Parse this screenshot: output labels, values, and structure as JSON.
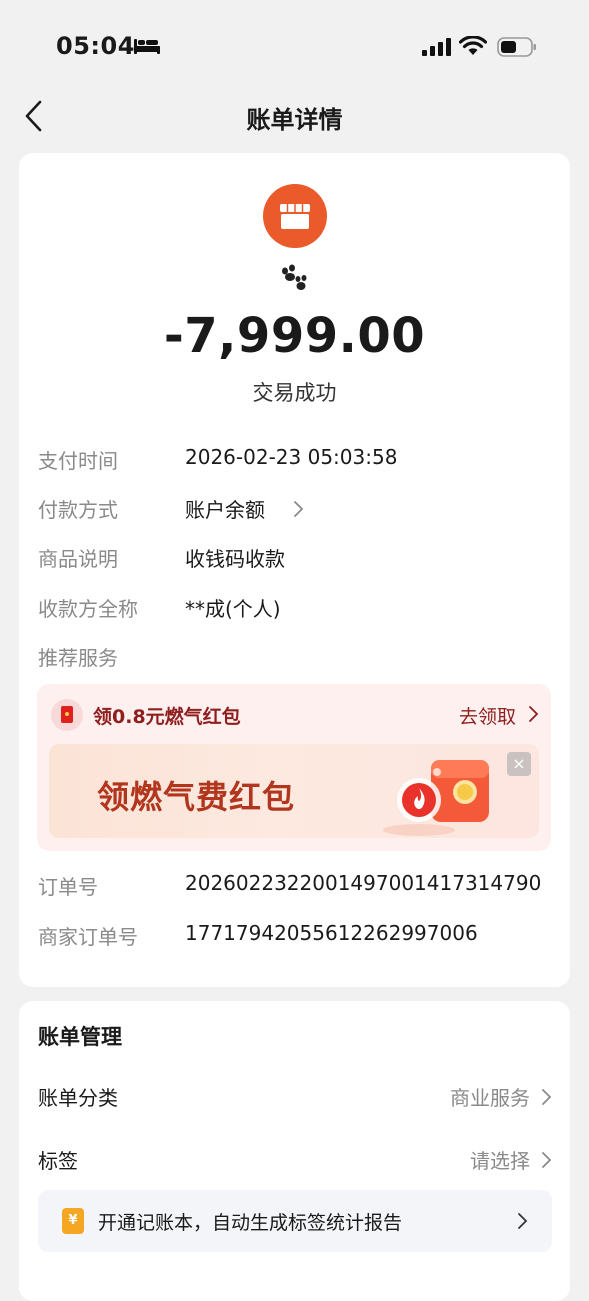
{
  "status_bar": {
    "time": "05:04",
    "icons": [
      "bed-icon",
      "signal-icon",
      "wifi-icon",
      "battery-icon"
    ]
  },
  "nav": {
    "title": "账单详情",
    "back_icon": "chevron-left-icon"
  },
  "transaction": {
    "merchant_icon": "shop-icon",
    "merchant_name_icon": "paw-icon",
    "amount": "-7,999.00",
    "status": "交易成功",
    "details": [
      {
        "label": "支付时间",
        "value": "2026-02-23 05:03:58",
        "has_arrow": false
      },
      {
        "label": "付款方式",
        "value": "账户余额",
        "has_arrow": true
      },
      {
        "label": "商品说明",
        "value": "收钱码收款",
        "has_arrow": false
      },
      {
        "label": "收款方全称",
        "value": "**成(个人)",
        "has_arrow": false
      },
      {
        "label": "推荐服务",
        "value": "",
        "has_arrow": false
      }
    ],
    "promo": {
      "title": "领0.8元燃气红包",
      "action": "去领取",
      "banner_text": "领燃气费红包",
      "close": "×"
    },
    "order_details": [
      {
        "label": "订单号",
        "value": "2026022322001497001417314790"
      },
      {
        "label": "商家订单号",
        "value": "17717942055612262997006"
      }
    ]
  },
  "manage": {
    "title": "账单管理",
    "rows": [
      {
        "label": "账单分类",
        "value": "商业服务"
      },
      {
        "label": "标签",
        "value": "请选择"
      }
    ],
    "ledger_promo": {
      "icon_text": "¥",
      "text": "开通记账本，自动生成标签统计报告"
    }
  },
  "colors": {
    "accent_orange": "#ea5a2b",
    "promo_red": "#8f1f1f",
    "background": "#f1f1f1"
  }
}
